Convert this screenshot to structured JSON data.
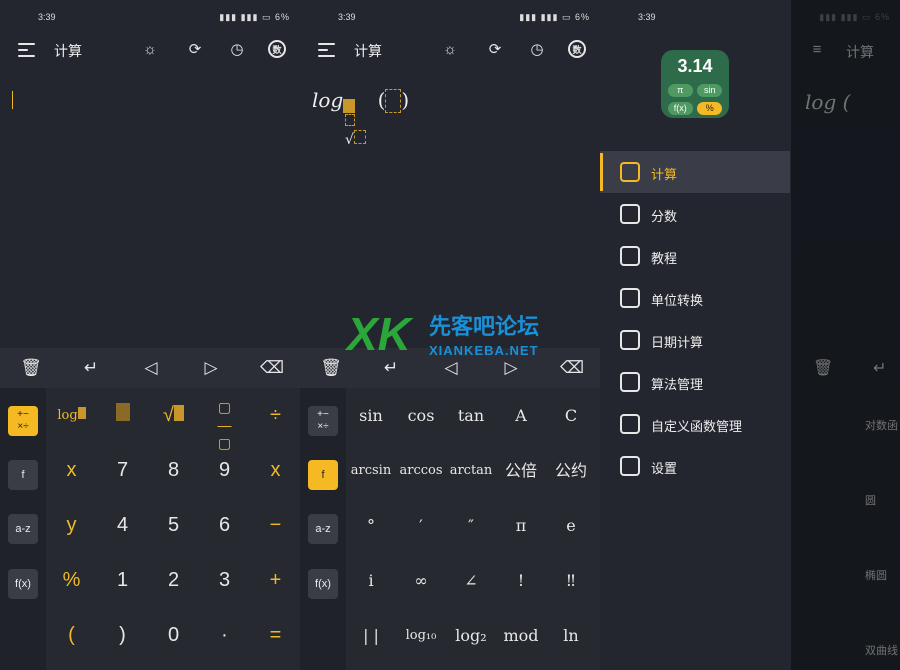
{
  "status": {
    "time": "3:39",
    "battery": "6%"
  },
  "title": "计算",
  "icons": {
    "shu": "数"
  },
  "expr": {
    "log": "log",
    "paren_open": "(",
    "paren_close": ")"
  },
  "keypad1": [
    [
      "x",
      "7",
      "8",
      "9",
      "x"
    ],
    [
      "y",
      "4",
      "5",
      "6",
      "−"
    ],
    [
      "%",
      "1",
      "2",
      "3",
      "+"
    ],
    [
      "(",
      ")",
      "0",
      "·",
      "="
    ]
  ],
  "keypad1_top": [
    "log",
    "",
    "√",
    "",
    "÷"
  ],
  "side": {
    "ops": "+−\n×÷",
    "f": "f",
    "az": "a-z",
    "fx": "f(x)"
  },
  "keypad2": [
    [
      "sin",
      "cos",
      "tan",
      "A",
      "C"
    ],
    [
      "arcsin",
      "arccos",
      "arctan",
      "公倍",
      "公约"
    ],
    [
      "°",
      "′",
      "″",
      "π",
      "e"
    ],
    [
      "i",
      "∞",
      "∠",
      "!",
      "‼"
    ],
    [
      "| |",
      "log₁₀",
      "log₂",
      "mod",
      "ln"
    ]
  ],
  "logo": {
    "big": "3.14",
    "p1": "π",
    "p2": "sin",
    "p3": "f(x)",
    "p4": "%"
  },
  "menu": [
    {
      "label": "计算",
      "icon": "calculator-icon"
    },
    {
      "label": "分数",
      "icon": "fraction-icon"
    },
    {
      "label": "教程",
      "icon": "book-icon"
    },
    {
      "label": "单位转换",
      "icon": "convert-icon"
    },
    {
      "label": "日期计算",
      "icon": "calendar-icon"
    },
    {
      "label": "算法管理",
      "icon": "grid-icon"
    },
    {
      "label": "自定义函数管理",
      "icon": "function-icon"
    },
    {
      "label": "设置",
      "icon": "gear-icon"
    }
  ],
  "overlay_side": [
    "对数函",
    "圆",
    "椭圆",
    "双曲线"
  ],
  "watermark": {
    "zh": "先客吧论坛",
    "en": "XIANKEBA.NET",
    "mark": "XK"
  }
}
